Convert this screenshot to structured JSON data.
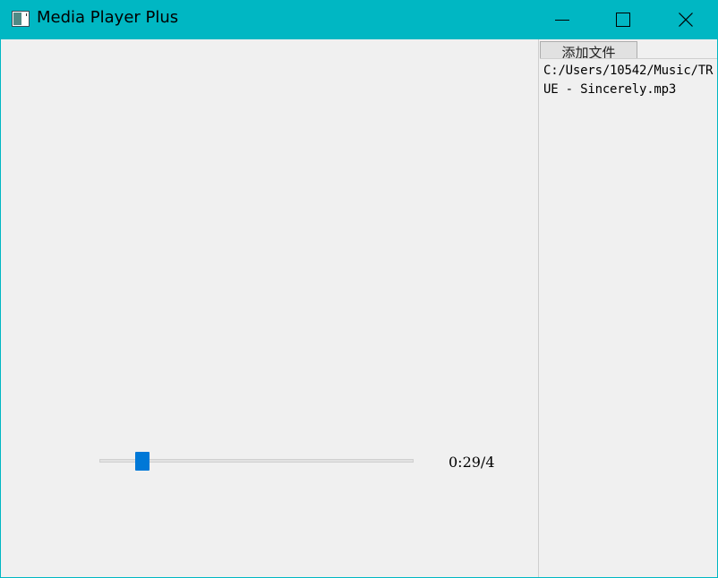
{
  "window": {
    "title": "Media Player Plus",
    "controls": {
      "minimize": "minimize-icon",
      "maximize": "maximize-icon",
      "close": "close-icon"
    }
  },
  "player": {
    "time_text": "0:29/4",
    "progress_fraction": 0.12
  },
  "sidebar": {
    "add_button_label": "添加文件",
    "playlist": [
      "C:/Users/10542/Music/TRUE - Sincerely.mp3"
    ]
  },
  "colors": {
    "titlebar": "#00b7c3",
    "client_bg": "#f0f0f0",
    "slider_thumb": "#0078d7"
  }
}
